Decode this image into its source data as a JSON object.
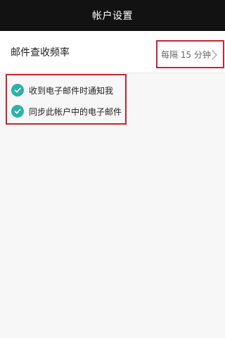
{
  "header": {
    "title": "帐户设置"
  },
  "settings": {
    "frequency": {
      "label": "邮件查收频率",
      "value": "每隔 15 分钟"
    },
    "checkboxes": [
      {
        "label": "收到电子邮件时通知我",
        "checked": true
      },
      {
        "label": "同步此帐户中的电子邮件",
        "checked": true
      }
    ]
  },
  "colors": {
    "header_bg": "#121212",
    "accent_check": "#2bb3a8",
    "highlight_border": "#c8242f"
  },
  "icons": {
    "frequency_arrow": "chevron-right-icon",
    "checkbox": "check-icon"
  }
}
